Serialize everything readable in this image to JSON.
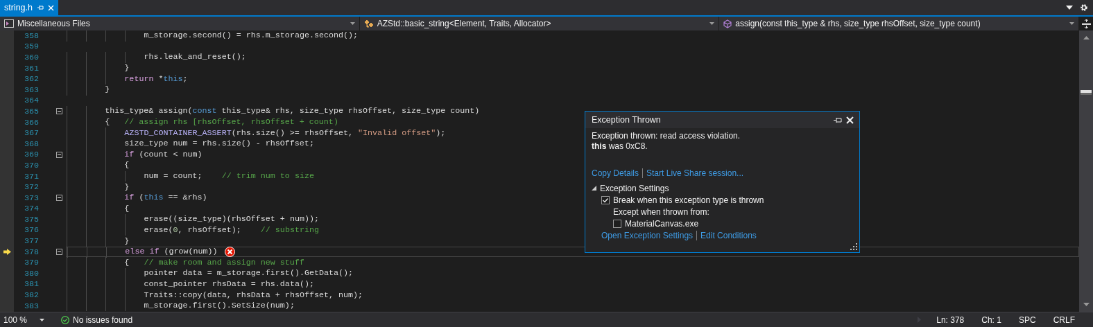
{
  "tab": {
    "title": "string.h",
    "selected": true
  },
  "nav": [
    {
      "kind": "project",
      "label": "Miscellaneous Files"
    },
    {
      "kind": "class",
      "label": "AZStd::basic_string<Element, Traits, Allocator>"
    },
    {
      "kind": "method",
      "label": "assign(const this_type & rhs, size_type rhsOffset, size_type count)"
    }
  ],
  "lines": [
    {
      "number": "358",
      "current": false,
      "fold": false,
      "error": false,
      "tokens": [
        {
          "kind": "plain",
          "t": "                m_storage.second() = rhs.m_storage.second();"
        }
      ]
    },
    {
      "number": "359",
      "current": false,
      "fold": false,
      "error": false
    },
    {
      "number": "360",
      "current": false,
      "fold": false,
      "error": false,
      "tokens": [
        {
          "kind": "plain",
          "t": "                rhs.leak_and_reset();"
        }
      ]
    },
    {
      "number": "361",
      "current": false,
      "fold": false,
      "error": false,
      "tokens": [
        {
          "kind": "plain",
          "t": "            }"
        }
      ]
    },
    {
      "number": "362",
      "current": false,
      "fold": false,
      "error": false,
      "tokens": [
        {
          "kind": "control",
          "t": "            return"
        },
        {
          "kind": "plain",
          "t": " *"
        },
        {
          "kind": "keyword",
          "t": "this"
        },
        {
          "kind": "plain",
          "t": ";"
        }
      ]
    },
    {
      "number": "363",
      "current": false,
      "fold": false,
      "error": false,
      "tokens": [
        {
          "kind": "plain",
          "t": "        }"
        }
      ]
    },
    {
      "number": "364",
      "current": false,
      "fold": false,
      "error": false
    },
    {
      "number": "365",
      "current": false,
      "fold": true,
      "error": false,
      "tokens": [
        {
          "kind": "plain",
          "t": "        this_type& assign("
        },
        {
          "kind": "keyword",
          "t": "const"
        },
        {
          "kind": "plain",
          "t": " this_type& rhs, size_type rhsOffset, size_type count)"
        }
      ]
    },
    {
      "number": "366",
      "current": false,
      "fold": false,
      "error": false,
      "tokens": [
        {
          "kind": "plain",
          "t": "        {   "
        },
        {
          "kind": "comment",
          "t": "// assign rhs [rhsOffset, rhsOffset + count)"
        }
      ]
    },
    {
      "number": "367",
      "current": false,
      "fold": false,
      "error": false,
      "tokens": [
        {
          "kind": "macro",
          "t": "            AZSTD_CONTAINER_ASSERT"
        },
        {
          "kind": "plain",
          "t": "(rhs.size() >= rhsOffset, "
        },
        {
          "kind": "string",
          "t": "\"Invalid offset\""
        },
        {
          "kind": "plain",
          "t": ");"
        }
      ]
    },
    {
      "number": "368",
      "current": false,
      "fold": false,
      "error": false,
      "tokens": [
        {
          "kind": "plain",
          "t": "            size_type num = rhs.size() - rhsOffset;"
        }
      ]
    },
    {
      "number": "369",
      "current": false,
      "fold": true,
      "error": false,
      "tokens": [
        {
          "kind": "control",
          "t": "            if"
        },
        {
          "kind": "plain",
          "t": " (count < num)"
        }
      ]
    },
    {
      "number": "370",
      "current": false,
      "fold": false,
      "error": false,
      "tokens": [
        {
          "kind": "plain",
          "t": "            {"
        }
      ]
    },
    {
      "number": "371",
      "current": false,
      "fold": false,
      "error": false,
      "tokens": [
        {
          "kind": "plain",
          "t": "                num = count;    "
        },
        {
          "kind": "comment",
          "t": "// trim num to size"
        }
      ]
    },
    {
      "number": "372",
      "current": false,
      "fold": false,
      "error": false,
      "tokens": [
        {
          "kind": "plain",
          "t": "            }"
        }
      ]
    },
    {
      "number": "373",
      "current": false,
      "fold": true,
      "error": false,
      "tokens": [
        {
          "kind": "control",
          "t": "            if"
        },
        {
          "kind": "plain",
          "t": " ("
        },
        {
          "kind": "keyword",
          "t": "this"
        },
        {
          "kind": "plain",
          "t": " == &rhs)"
        }
      ]
    },
    {
      "number": "374",
      "current": false,
      "fold": false,
      "error": false,
      "tokens": [
        {
          "kind": "plain",
          "t": "            {"
        }
      ]
    },
    {
      "number": "375",
      "current": false,
      "fold": false,
      "error": false,
      "tokens": [
        {
          "kind": "plain",
          "t": "                erase((size_type)(rhsOffset + num));"
        }
      ]
    },
    {
      "number": "376",
      "current": false,
      "fold": false,
      "error": false,
      "tokens": [
        {
          "kind": "plain",
          "t": "                erase("
        },
        {
          "kind": "number",
          "t": "0"
        },
        {
          "kind": "plain",
          "t": ", rhsOffset);    "
        },
        {
          "kind": "comment",
          "t": "// substring"
        }
      ]
    },
    {
      "number": "377",
      "current": false,
      "fold": false,
      "error": false,
      "tokens": [
        {
          "kind": "plain",
          "t": "            }"
        }
      ]
    },
    {
      "number": "378",
      "current": true,
      "fold": true,
      "error": true,
      "tokens": [
        {
          "kind": "control",
          "t": "            else if"
        },
        {
          "kind": "plain",
          "t": " (grow(num))"
        }
      ]
    },
    {
      "number": "379",
      "current": false,
      "fold": false,
      "error": false,
      "tokens": [
        {
          "kind": "plain",
          "t": "            {   "
        },
        {
          "kind": "comment",
          "t": "// make room and assign new stuff"
        }
      ]
    },
    {
      "number": "380",
      "current": false,
      "fold": false,
      "error": false,
      "tokens": [
        {
          "kind": "plain",
          "t": "                pointer data = m_storage.first().GetData();"
        }
      ]
    },
    {
      "number": "381",
      "current": false,
      "fold": false,
      "error": false,
      "tokens": [
        {
          "kind": "plain",
          "t": "                const_pointer rhsData = rhs.data();"
        }
      ]
    },
    {
      "number": "382",
      "current": false,
      "fold": false,
      "error": false,
      "tokens": [
        {
          "kind": "plain",
          "t": "                Traits::copy(data, rhsData + rhsOffset, num);"
        }
      ]
    },
    {
      "number": "383",
      "current": false,
      "fold": false,
      "error": false,
      "tokens": [
        {
          "kind": "plain",
          "t": "                m_storage.first().SetSize(num);"
        }
      ]
    }
  ],
  "popup": {
    "title": "Exception Thrown",
    "message": [
      "Exception thrown: read access violation.",
      "**this** was 0xC8."
    ],
    "links": [
      "Copy Details",
      "Start Live Share session..."
    ],
    "settings": {
      "label": "Exception Settings",
      "expanded": true,
      "items": [
        {
          "kind": "checkbox",
          "label": "Break when this exception type is thrown",
          "checked": true
        },
        {
          "kind": "label",
          "label": "Except when thrown from:"
        },
        {
          "kind": "checkbox",
          "label": "MaterialCanvas.exe",
          "checked": false
        }
      ]
    },
    "footer_links": [
      "Open Exception Settings",
      "Edit Conditions"
    ]
  },
  "status_bar": {
    "zoom": "100 %",
    "issues": "No issues found",
    "fields": [
      "Ln: 378",
      "Ch: 1",
      "SPC",
      "CRLF"
    ]
  }
}
